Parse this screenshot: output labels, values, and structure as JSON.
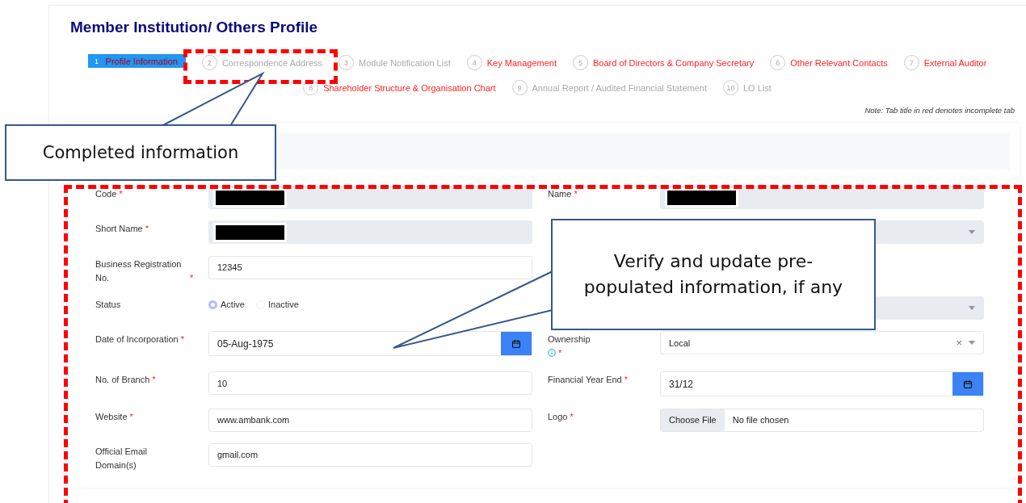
{
  "title": "Member Institution/ Others Profile",
  "steps": [
    {
      "number": "1",
      "label": "Profile Information",
      "selected": true,
      "complete": false
    },
    {
      "number": "2",
      "label": "Correspondence Address",
      "selected": false,
      "complete": true
    },
    {
      "number": "3",
      "label": "Module Notification List",
      "selected": false,
      "complete": true
    },
    {
      "number": "4",
      "label": "Key Management",
      "selected": false,
      "complete": false
    },
    {
      "number": "5",
      "label": "Board of Directors & Company Secretary",
      "selected": false,
      "complete": false
    },
    {
      "number": "6",
      "label": "Other Relevant Contacts",
      "selected": false,
      "complete": false
    },
    {
      "number": "7",
      "label": "External Auditor",
      "selected": false,
      "complete": false
    },
    {
      "number": "8",
      "label": "Shareholder Structure & Organisation Chart",
      "selected": false,
      "complete": false
    },
    {
      "number": "9",
      "label": "Annual Report / Audited Financial Statement",
      "selected": false,
      "complete": true
    },
    {
      "number": "10",
      "label": "LO List",
      "selected": false,
      "complete": true
    }
  ],
  "note": "Note: Tab title in red denotes incomplete tab",
  "required_mark": "*",
  "rows": [
    {
      "left": {
        "label": "Code",
        "required": true,
        "kind": "redacted"
      },
      "right": {
        "label": "Name",
        "required": true,
        "kind": "redacted"
      }
    },
    {
      "left": {
        "label": "Short Name",
        "required": true,
        "kind": "redacted"
      },
      "right": {
        "kind": "select",
        "disabled": true
      }
    },
    {
      "left": {
        "label": "Business Registration No.",
        "required": true,
        "kind": "text",
        "value": "12345"
      },
      "right": {
        "kind": "none"
      }
    },
    {
      "left": {
        "label": "Status",
        "kind": "radio",
        "options": [
          {
            "label": "Active",
            "selected": true
          },
          {
            "label": "Inactive",
            "selected": false
          }
        ]
      },
      "right": {
        "kind": "select",
        "disabled": true
      }
    },
    {
      "left": {
        "label": "Date of Incorporation",
        "required": true,
        "kind": "date",
        "value": "05-Aug-1975"
      },
      "right": {
        "label": "Ownership",
        "required": true,
        "info": true,
        "kind": "select",
        "value": "Local",
        "clear": "×"
      }
    },
    {
      "left": {
        "label": "No. of Branch",
        "required": true,
        "kind": "text",
        "value": "10"
      },
      "right": {
        "label": "Financial Year End",
        "required": true,
        "kind": "date",
        "value": "31/12"
      }
    },
    {
      "left": {
        "label": "Website",
        "required": true,
        "kind": "text",
        "value": "www.ambank.com"
      },
      "right": {
        "label": "Logo",
        "required": true,
        "kind": "file",
        "button": "Choose File",
        "value": "No file chosen"
      }
    },
    {
      "left": {
        "label": "Official Email Domain(s)",
        "kind": "text",
        "value": "gmail.com"
      },
      "right": {
        "kind": "none"
      }
    }
  ],
  "callouts": [
    {
      "text": "Completed information",
      "kind": "top"
    },
    {
      "text": "Verify and update pre-populated information, if any",
      "kind": "left"
    }
  ]
}
